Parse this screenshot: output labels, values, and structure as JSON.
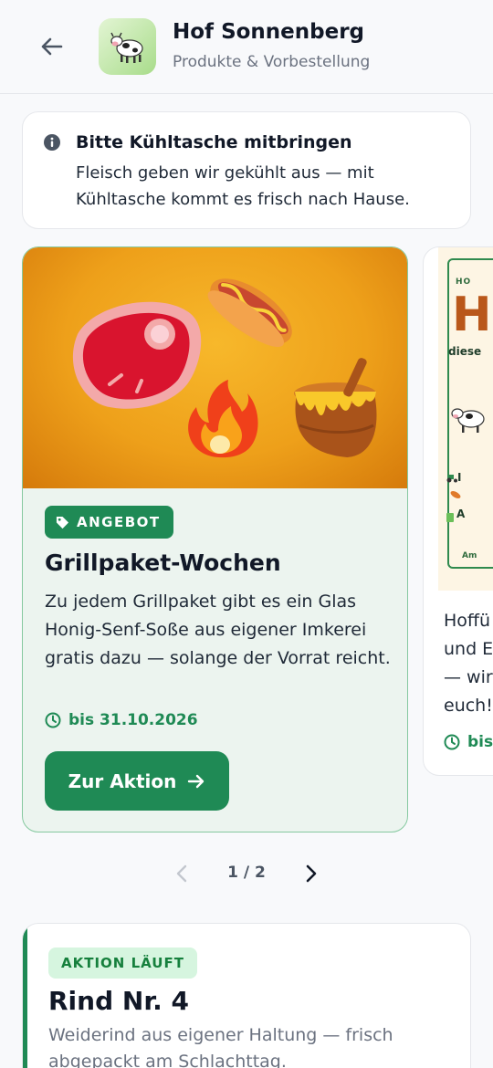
{
  "header": {
    "title": "Hof Sonnenberg",
    "subtitle": "Produkte & Vorbestellung",
    "logo_icon": "cow",
    "back_icon": "arrow-left-icon"
  },
  "notice": {
    "title": "Bitte Kühltasche mitbringen",
    "text": "Fleisch geben wir gekühlt aus — mit Kühltasche kommt es frisch nach Hause."
  },
  "offers": [
    {
      "badge": "ANGEBOT",
      "title": "Grillpaket-Wochen",
      "text": "Zu jedem Grillpaket gibt es ein Glas Honig-Senf-Soße aus eigener Imkerei gratis dazu — solange der Vorrat reicht.",
      "date": "bis 31.10.2026",
      "cta": "Zur Aktion"
    },
    {
      "poster_small": "HO",
      "poster_big": "H",
      "poster_mid": "diese",
      "poster_row1": "I",
      "poster_row3": "A",
      "poster_foot": "Am",
      "text": "Hoffü\nund E\n— wir\neuch!",
      "date": "bis"
    }
  ],
  "pager": {
    "label": "1 / 2"
  },
  "product": {
    "badge": "AKTION LÄUFT",
    "title": "Rind Nr. 4",
    "text": "Weiderind aus eigener Haltung — frisch abgepackt am Schlachttag."
  },
  "colors": {
    "accent": "#1f8a55",
    "accent_light": "#d6f5df",
    "offer_bg": "#ecf4ef"
  }
}
